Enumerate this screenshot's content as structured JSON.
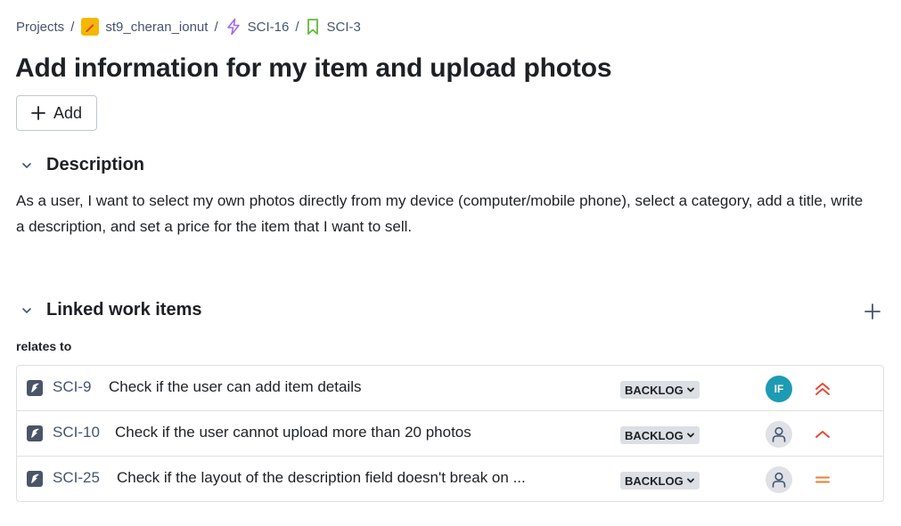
{
  "breadcrumb": {
    "items": [
      {
        "label": "Projects"
      },
      {
        "label": "st9_cheran_ionut"
      },
      {
        "label": "SCI-16"
      },
      {
        "label": "SCI-3"
      }
    ],
    "separator": "/"
  },
  "title": "Add information for my item and upload photos",
  "add_button": {
    "label": "Add"
  },
  "description": {
    "heading": "Description",
    "text": "As a user, I want to select my own photos directly from my device (computer/mobile phone), select a category, add a title, write a description, and set a price for the item that I want to sell."
  },
  "linked": {
    "heading": "Linked work items",
    "relation": "relates to",
    "items": [
      {
        "key": "SCI-9",
        "summary": "Check if the user can add item details",
        "status": "BACKLOG",
        "assignee": "IF",
        "priority_icon": "highest-priority-icon"
      },
      {
        "key": "SCI-10",
        "summary": "Check if the user cannot upload more than 20 photos",
        "status": "BACKLOG",
        "assignee": "",
        "priority_icon": "high-priority-icon"
      },
      {
        "key": "SCI-25",
        "summary": "Check if the layout of the description field doesn't break on ...",
        "status": "BACKLOG",
        "assignee": "",
        "priority_icon": "medium-priority-icon"
      }
    ]
  },
  "colors": {
    "project_icon": "#f5b800",
    "epic_icon": "#9f6be8",
    "story_icon": "#63ba3c",
    "priority_high": "#e5493a",
    "priority_medium": "#e97f33",
    "avatar_if": "#1d9bb2"
  }
}
